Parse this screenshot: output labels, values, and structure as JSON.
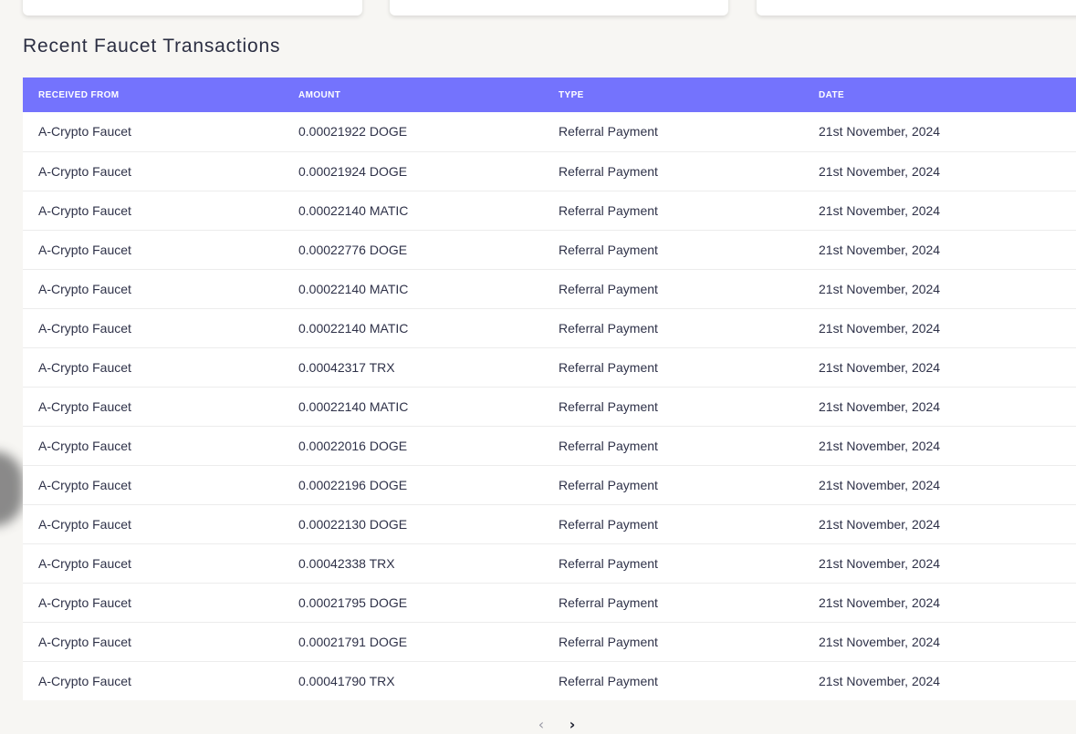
{
  "section": {
    "title": "Recent Faucet Transactions"
  },
  "table": {
    "columns": [
      "RECEIVED FROM",
      "AMOUNT",
      "TYPE",
      "DATE"
    ],
    "rows": [
      [
        "A-Crypto Faucet",
        "0.00021922 DOGE",
        "Referral Payment",
        "21st November, 2024"
      ],
      [
        "A-Crypto Faucet",
        "0.00021924 DOGE",
        "Referral Payment",
        "21st November, 2024"
      ],
      [
        "A-Crypto Faucet",
        "0.00022140 MATIC",
        "Referral Payment",
        "21st November, 2024"
      ],
      [
        "A-Crypto Faucet",
        "0.00022776 DOGE",
        "Referral Payment",
        "21st November, 2024"
      ],
      [
        "A-Crypto Faucet",
        "0.00022140 MATIC",
        "Referral Payment",
        "21st November, 2024"
      ],
      [
        "A-Crypto Faucet",
        "0.00022140 MATIC",
        "Referral Payment",
        "21st November, 2024"
      ],
      [
        "A-Crypto Faucet",
        "0.00042317 TRX",
        "Referral Payment",
        "21st November, 2024"
      ],
      [
        "A-Crypto Faucet",
        "0.00022140 MATIC",
        "Referral Payment",
        "21st November, 2024"
      ],
      [
        "A-Crypto Faucet",
        "0.00022016 DOGE",
        "Referral Payment",
        "21st November, 2024"
      ],
      [
        "A-Crypto Faucet",
        "0.00022196 DOGE",
        "Referral Payment",
        "21st November, 2024"
      ],
      [
        "A-Crypto Faucet",
        "0.00022130 DOGE",
        "Referral Payment",
        "21st November, 2024"
      ],
      [
        "A-Crypto Faucet",
        "0.00042338 TRX",
        "Referral Payment",
        "21st November, 2024"
      ],
      [
        "A-Crypto Faucet",
        "0.00021795 DOGE",
        "Referral Payment",
        "21st November, 2024"
      ],
      [
        "A-Crypto Faucet",
        "0.00021791 DOGE",
        "Referral Payment",
        "21st November, 2024"
      ],
      [
        "A-Crypto Faucet",
        "0.00041790 TRX",
        "Referral Payment",
        "21st November, 2024"
      ]
    ]
  },
  "pagination": {
    "prev_icon": "chevron-left-icon",
    "next_icon": "chevron-right-icon"
  },
  "colors": {
    "header_bg": "#7473fd",
    "page_bg": "#f7f6f3"
  }
}
